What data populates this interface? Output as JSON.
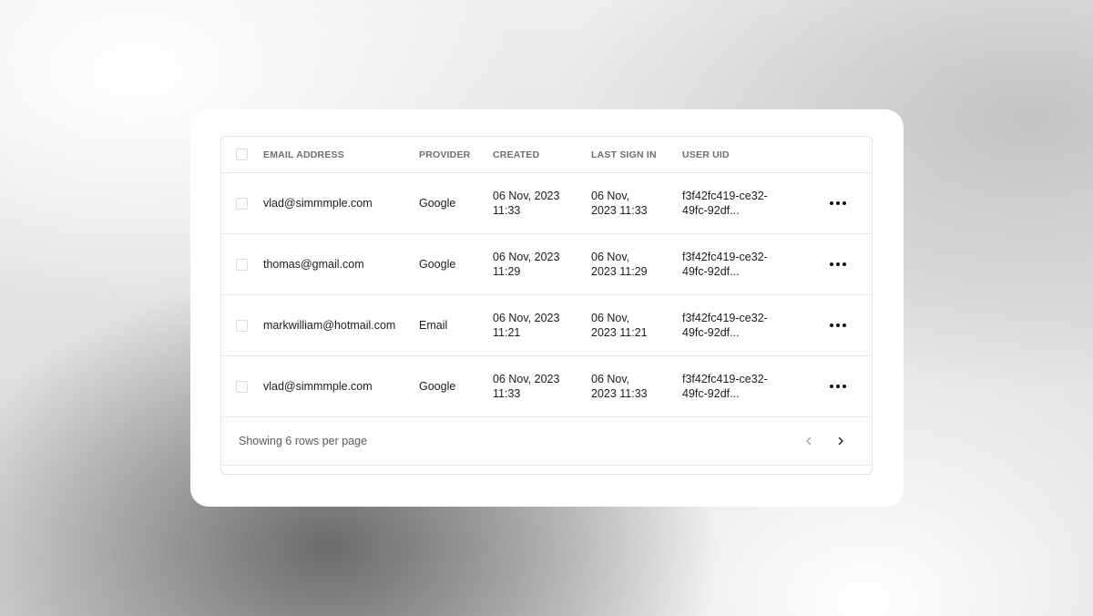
{
  "table": {
    "headers": {
      "email": "EMAIL ADDRESS",
      "provider": "PROVIDER",
      "created": "CREATED",
      "last_sign_in": "LAST SIGN IN",
      "user_uid": "USER UID"
    },
    "rows": [
      {
        "email": "vlad@simmmple.com",
        "provider": "Google",
        "created": [
          "06 Nov, 2023",
          "11:33"
        ],
        "last_sign_in": [
          "06 Nov,",
          "2023 11:33"
        ],
        "user_uid": [
          "f3f42fc419-ce32-",
          "49fc-92df..."
        ]
      },
      {
        "email": "thomas@gmail.com",
        "provider": "Google",
        "created": [
          "06 Nov, 2023",
          "11:29"
        ],
        "last_sign_in": [
          "06 Nov,",
          "2023 11:29"
        ],
        "user_uid": [
          "f3f42fc419-ce32-",
          "49fc-92df..."
        ]
      },
      {
        "email": "markwilliam@hotmail.com",
        "provider": "Email",
        "created": [
          "06 Nov, 2023",
          "11:21"
        ],
        "last_sign_in": [
          "06 Nov,",
          "2023 11:21"
        ],
        "user_uid": [
          "f3f42fc419-ce32-",
          "49fc-92df..."
        ]
      },
      {
        "email": "vlad@simmmple.com",
        "provider": "Google",
        "created": [
          "06 Nov, 2023",
          "11:33"
        ],
        "last_sign_in": [
          "06 Nov,",
          "2023 11:33"
        ],
        "user_uid": [
          "f3f42fc419-ce32-",
          "49fc-92df..."
        ]
      }
    ]
  },
  "footer": {
    "text": "Showing 6 rows per page"
  },
  "icons": {
    "more": "more-horizontal-icon",
    "prev": "chevron-left-icon",
    "next": "chevron-right-icon"
  }
}
